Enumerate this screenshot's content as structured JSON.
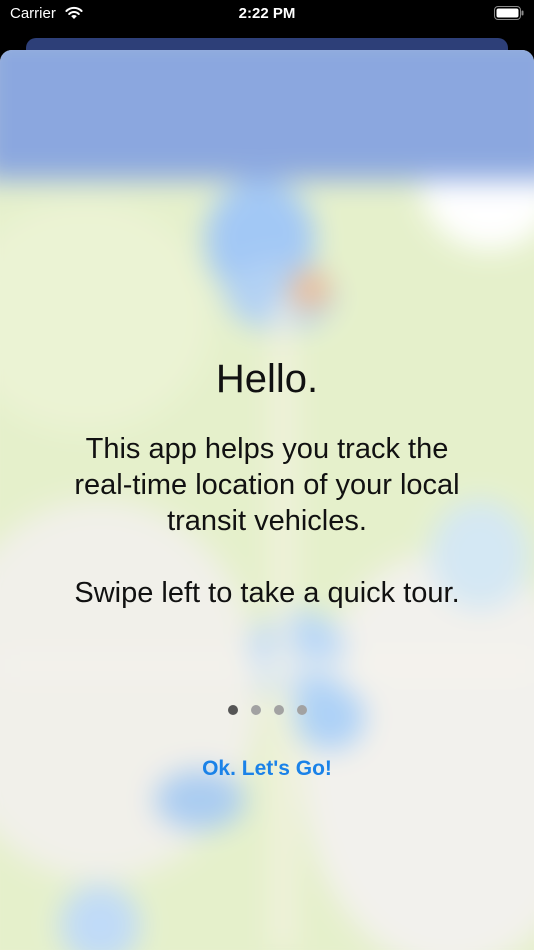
{
  "status_bar": {
    "carrier": "Carrier",
    "time": "2:22 PM"
  },
  "onboarding": {
    "title": "Hello.",
    "description": "This app helps you track the real-time location of your local transit vehicles.",
    "instruction": "Swipe left to take a quick tour.",
    "page_indicator": {
      "total": 4,
      "current": 1
    },
    "ok_button_label": "Ok. Let's Go!"
  },
  "colors": {
    "accent": "#1a82e8",
    "map_header": "#5f86d3",
    "map_green": "#d9ecb0",
    "status_bar_bg": "#000000"
  },
  "icons": [
    "wifi-icon",
    "battery-icon"
  ]
}
